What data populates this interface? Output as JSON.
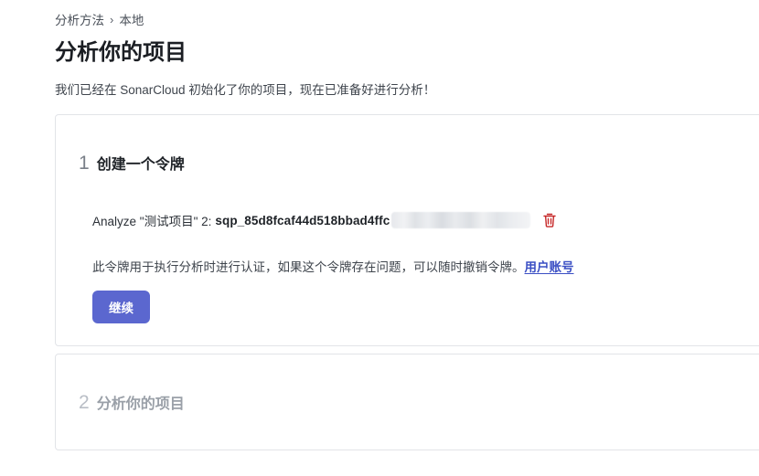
{
  "breadcrumb": {
    "items": [
      "分析方法",
      "本地"
    ],
    "separator": "›"
  },
  "page": {
    "title": "分析你的项目",
    "subtitle": "我们已经在 SonarCloud 初始化了你的项目，现在已准备好进行分析！"
  },
  "steps": [
    {
      "number": "1",
      "title": "创建一个令牌",
      "token_label": "Analyze \"测试项目\" 2:",
      "token_value": "sqp_85d8fcaf44d518bbad4ffc",
      "info_text": "此令牌用于执行分析时进行认证，如果这个令牌存在问题，可以随时撤销令牌。",
      "info_link": "用户账号",
      "continue_label": "继续"
    },
    {
      "number": "2",
      "title": "分析你的项目"
    }
  ],
  "colors": {
    "accent": "#5b67cf",
    "link": "#3b4fc4",
    "danger": "#c62828",
    "border": "#e2e4e8"
  },
  "icons": {
    "delete": "trash-icon"
  }
}
